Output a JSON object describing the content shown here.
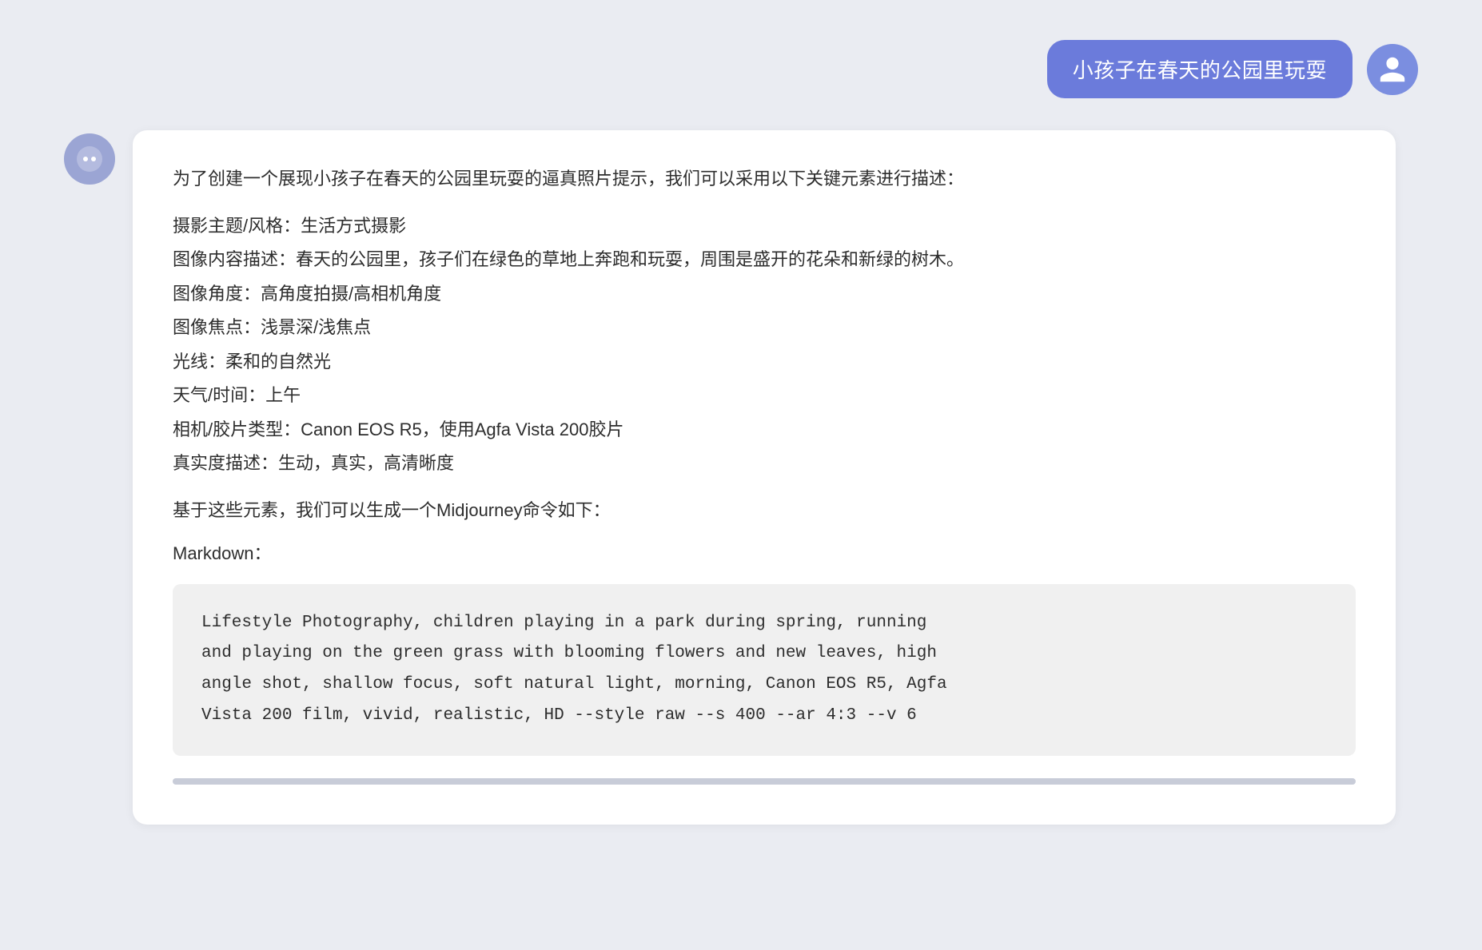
{
  "page": {
    "background_color": "#eaecf2"
  },
  "user_message": {
    "text": "小孩子在春天的公园里玩耍"
  },
  "ai_response": {
    "intro": "为了创建一个展现小孩子在春天的公园里玩耍的逼真照片提示，我们可以采用以下关键元素进行描述：",
    "fields": [
      {
        "label": "摄影主题/风格：",
        "value": "生活方式摄影"
      },
      {
        "label": "图像内容描述：",
        "value": "春天的公园里，孩子们在绿色的草地上奔跑和玩耍，周围是盛开的花朵和新绿的树木。"
      },
      {
        "label": "图像角度：",
        "value": "高角度拍摄/高相机角度"
      },
      {
        "label": "图像焦点：",
        "value": "浅景深/浅焦点"
      },
      {
        "label": "光线：",
        "value": "柔和的自然光"
      },
      {
        "label": "天气/时间：",
        "value": "上午"
      },
      {
        "label": "相机/胶片类型：",
        "value": "Canon EOS R5，使用Agfa Vista 200胶片"
      },
      {
        "label": "真实度描述：",
        "value": "生动，真实，高清晰度"
      }
    ],
    "midjourney_intro": "基于这些元素，我们可以生成一个Midjourney命令如下：",
    "markdown_label": "Markdown：",
    "code": "Lifestyle Photography, children playing in a park during spring, running\nand playing on the green grass with blooming flowers and new leaves, high\nangle shot, shallow focus, soft natural light, morning, Canon EOS R5, Agfa\nVista 200 film, vivid, realistic, HD --style raw --s 400 --ar 4:3 --v 6"
  }
}
